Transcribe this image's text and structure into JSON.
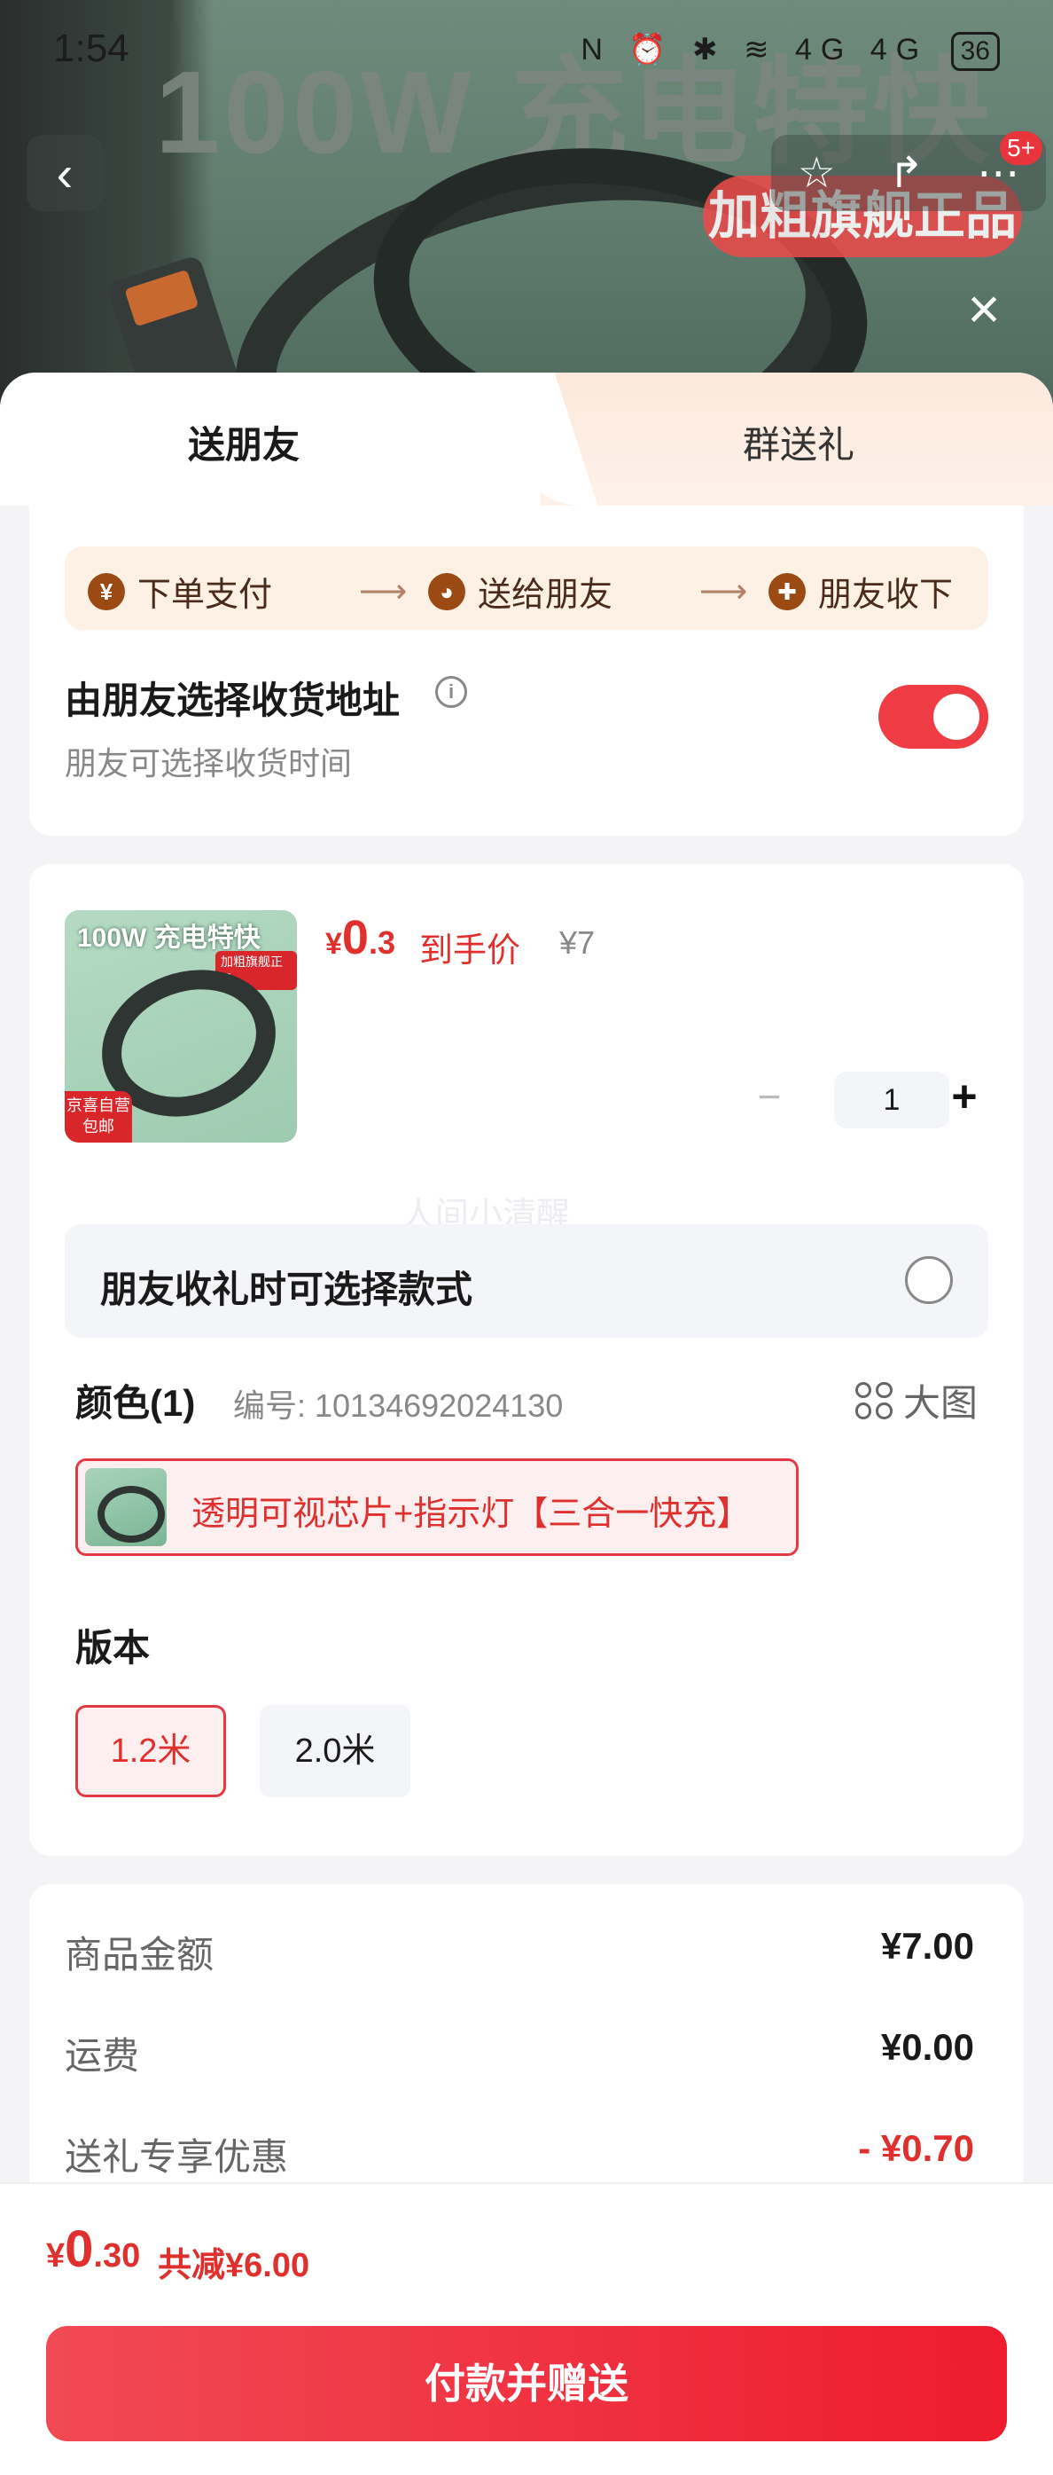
{
  "status_bar": {
    "time": "1:54",
    "icons_text": "N ⏰ ✱ ≋ 4G 4G",
    "battery": "36"
  },
  "backdrop": {
    "banner_text": "100W 充电特快",
    "badge_text": "加粗旗舰正品",
    "notification_count": "5+"
  },
  "tabs": [
    {
      "label": "送朋友",
      "active": true
    },
    {
      "label": "群送礼",
      "active": false
    }
  ],
  "flow": {
    "steps": [
      {
        "icon": "yen-icon",
        "glyph": "¥",
        "label": "下单支付"
      },
      {
        "icon": "wechat-icon",
        "glyph": "◕",
        "label": "送给朋友"
      },
      {
        "icon": "gift-icon",
        "glyph": "✚",
        "label": "朋友收下"
      }
    ],
    "arrow": "⟶"
  },
  "address_option": {
    "title": "由朋友选择收货地址",
    "subtitle": "朋友可选择收货时间",
    "enabled": true
  },
  "product": {
    "thumb_title": "100W 充电特快",
    "thumb_badge": "加粗旗舰正品",
    "thumb_ship_line1": "京喜自营",
    "thumb_ship_line2": "包邮",
    "price_currency": "¥",
    "price_int": "0",
    "price_dec": ".3",
    "price_label": "到手价",
    "original_price": "¥7",
    "quantity": "1",
    "minus": "−",
    "plus": "+"
  },
  "watermark": "人间小清醒",
  "style_option": {
    "label": "朋友收礼时可选择款式",
    "checked": false
  },
  "color": {
    "heading": "颜色(1)",
    "code": "编号: 10134692024130",
    "big_image_label": "大图",
    "selected": "透明可视芯片+指示灯【三合一快充】"
  },
  "version": {
    "heading": "版本",
    "options": [
      {
        "label": "1.2米",
        "selected": true
      },
      {
        "label": "2.0米",
        "selected": false
      }
    ]
  },
  "summary": {
    "rows": [
      {
        "label": "商品金额",
        "value": "¥7.00"
      },
      {
        "label": "运费",
        "value": "¥0.00"
      },
      {
        "label": "送礼专享优惠",
        "value": "- ¥0.70"
      }
    ]
  },
  "footer": {
    "total_currency": "¥",
    "total_int": "0",
    "total_dec": ".30",
    "total_saved": "共减¥6.00",
    "pay_button": "付款并赠送"
  },
  "colors": {
    "accent_red": "#e0302e",
    "toggle_on": "#ef3b43",
    "pay_gradient_start": "#f14a55",
    "pay_gradient_end": "#ee1c2e",
    "flow_bg": "#fdf1e6",
    "flow_icon": "#9b4a14"
  }
}
